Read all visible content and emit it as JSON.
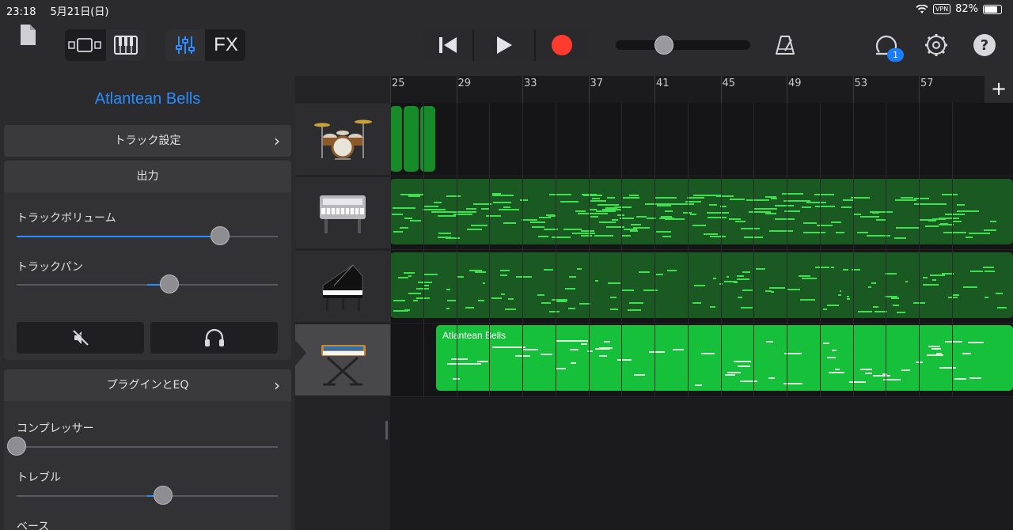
{
  "status": {
    "time": "23:18",
    "date": "5月21日(日)",
    "vpn": "VPN",
    "battery": "82%",
    "battery_level": 0.82
  },
  "toolbar": {
    "fx_label": "FX",
    "notification_count": "1",
    "track_position_fraction": 0.36,
    "icons": [
      "document-icon",
      "view-toggle-icon",
      "piano-keys-icon",
      "mixer-icon",
      "go-to-start-icon",
      "play-icon",
      "record-icon",
      "metronome-icon",
      "loop-browser-icon",
      "settings-gear-icon",
      "help-icon"
    ]
  },
  "inspector": {
    "title": "Atlantean Bells",
    "track_settings_label": "トラック設定",
    "output_header": "出力",
    "track_volume_label": "トラックボリューム",
    "track_volume_value": 0.78,
    "track_pan_label": "トラックパン",
    "track_pan_value": 0.17,
    "plugins_eq_label": "プラグインとEQ",
    "compressor_label": "コンプレッサー",
    "compressor_value": 0.0,
    "treble_label": "トレブル",
    "treble_value": 0.06,
    "bass_label": "ベース"
  },
  "tracks": [
    {
      "instrument": "drum-kit",
      "icon": "drum-kit-icon"
    },
    {
      "instrument": "electric-piano",
      "icon": "electric-piano-icon"
    },
    {
      "instrument": "grand-piano",
      "icon": "grand-piano-icon"
    },
    {
      "instrument": "synth-keyboard",
      "icon": "synth-keyboard-icon",
      "selected": true,
      "region_label": "Atlantean Bells"
    }
  ],
  "ruler": {
    "bars": [
      "25",
      "29",
      "33",
      "37",
      "41",
      "45",
      "49",
      "53",
      "57"
    ]
  },
  "colors": {
    "accent_blue": "#2a8dff",
    "record_red": "#ff3b30",
    "region_dark_green": "#1a5a22",
    "region_bright_green": "#16c03a",
    "note_green": "#3ee04f"
  }
}
